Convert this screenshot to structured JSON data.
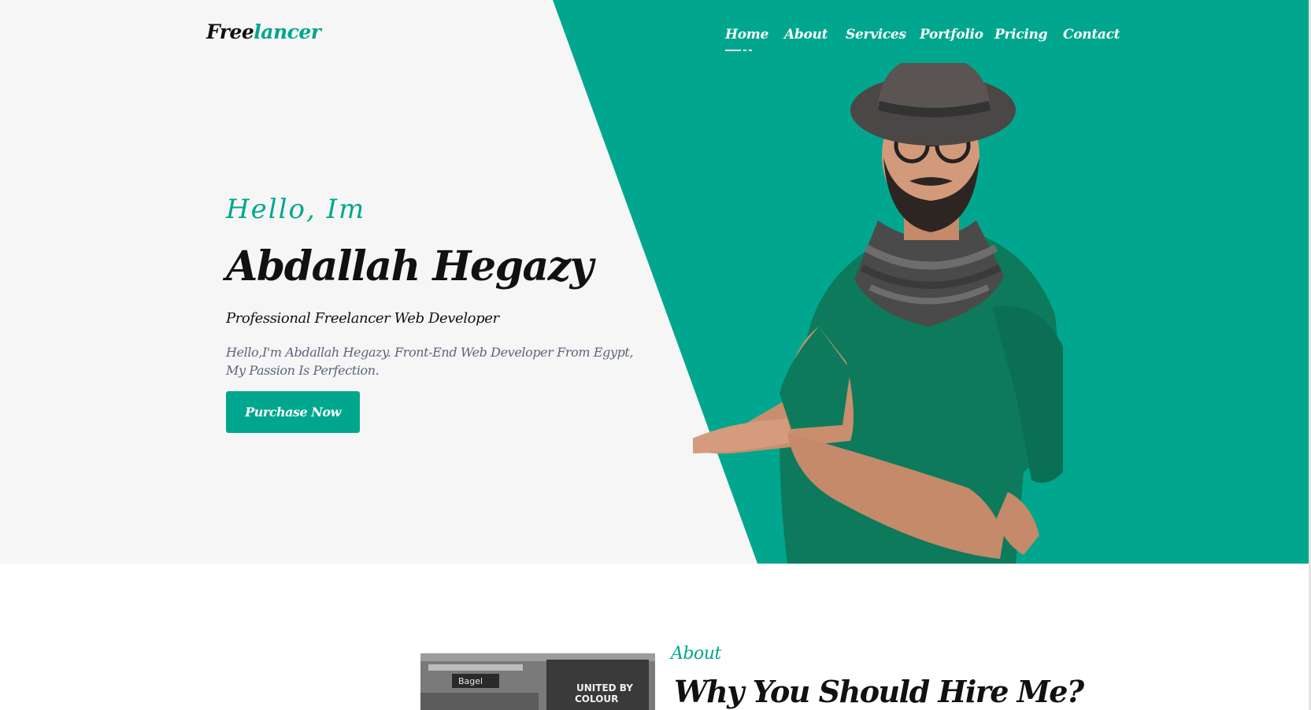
{
  "brand": {
    "logo_part1": "Free",
    "logo_part2": "lancer"
  },
  "nav": {
    "items": [
      {
        "label": "Home",
        "active": true
      },
      {
        "label": "About"
      },
      {
        "label": "Services"
      },
      {
        "label": "Portfolio"
      },
      {
        "label": "Pricing"
      },
      {
        "label": "Contact"
      }
    ]
  },
  "hero": {
    "greeting": "Hello, Im",
    "name": "Abdallah Hegazy",
    "role": "Professional Freelancer Web Developer",
    "description": "Hello,I'm Abdallah Hegazy. Front-End Web Developer From Egypt, My Passion Is Perfection.",
    "cta_label": "Purchase Now"
  },
  "about": {
    "eyebrow": "About",
    "title": "Why You Should Hire Me?",
    "image_text": [
      "Bagel",
      "UNITED BY",
      "COLOUR"
    ]
  },
  "colors": {
    "accent": "#00a78e",
    "hero_bg": "#f6f6f6",
    "text_dark": "#111111",
    "text_muted": "#5b6478"
  }
}
